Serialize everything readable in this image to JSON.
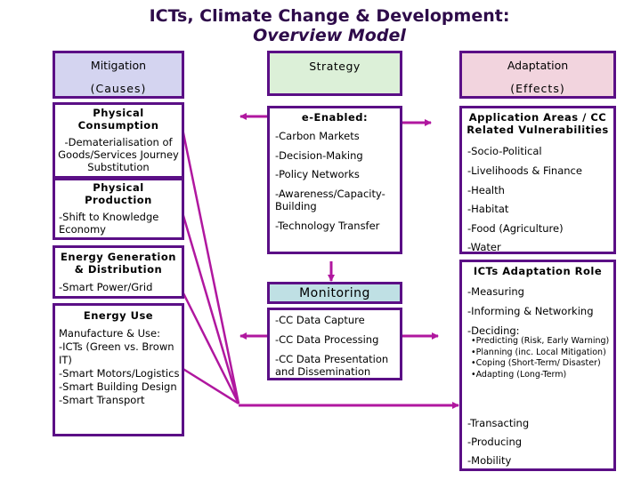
{
  "title": {
    "line1": "ICTs, Climate Change & Development:",
    "line2": "Overview Model"
  },
  "colors": {
    "border": "#5b0f86",
    "connector": "#b0179f",
    "title": "#2e0b4a",
    "mitigation_fill": "#d4d4f0",
    "strategy_fill": "#dcf0d8",
    "adaptation_fill": "#f2d4de",
    "monitoring_fill": "#bfe0e4"
  },
  "mitigation": {
    "header": {
      "line1": "Mitigation",
      "line2": "(Causes)"
    },
    "boxes": [
      {
        "title": "Physical Consumption",
        "items": [
          "-Dematerialisation of Goods/Services Journey Substitution"
        ]
      },
      {
        "title": "Physical Production",
        "items": [
          "-Shift to Knowledge Economy"
        ]
      },
      {
        "title": "Energy Generation & Distribution",
        "items": [
          "-Smart Power/Grid"
        ]
      },
      {
        "title": "Energy Use",
        "items": [
          "Manufacture & Use:",
          "-ICTs (Green vs. Brown IT)",
          "-Smart Motors/Logistics",
          "-Smart Building Design",
          "-Smart Transport"
        ]
      }
    ]
  },
  "strategy": {
    "header": "Strategy",
    "enabled": {
      "title": "e-Enabled:",
      "items": [
        "-Carbon Markets",
        "-Decision-Making",
        "-Policy Networks",
        "-Awareness/Capacity-Building",
        "-Technology Transfer"
      ]
    },
    "monitoring": {
      "title": "Monitoring",
      "items": [
        "-CC Data Capture",
        "-CC Data Processing",
        "-CC Data Presentation and Dissemination"
      ]
    }
  },
  "adaptation": {
    "header": {
      "line1": "Adaptation",
      "line2": "(Effects)"
    },
    "application": {
      "title": "Application Areas / CC Related Vulnerabilities",
      "items": [
        "-Socio-Political",
        "-Livelihoods & Finance",
        "-Health",
        "-Habitat",
        "-Food (Agriculture)",
        "-Water"
      ]
    },
    "role": {
      "title": "ICTs Adaptation Role",
      "items_top": [
        "-Measuring",
        "-Informing & Networking",
        "-Deciding:"
      ],
      "sub_items": [
        "•Predicting (Risk, Early Warning)",
        "•Planning (inc. Local Mitigation)",
        "•Coping (Short-Term/ Disaster)",
        "•Adapting (Long-Term)"
      ],
      "items_bottom": [
        "-Transacting",
        "-Producing",
        "-Mobility"
      ]
    }
  }
}
